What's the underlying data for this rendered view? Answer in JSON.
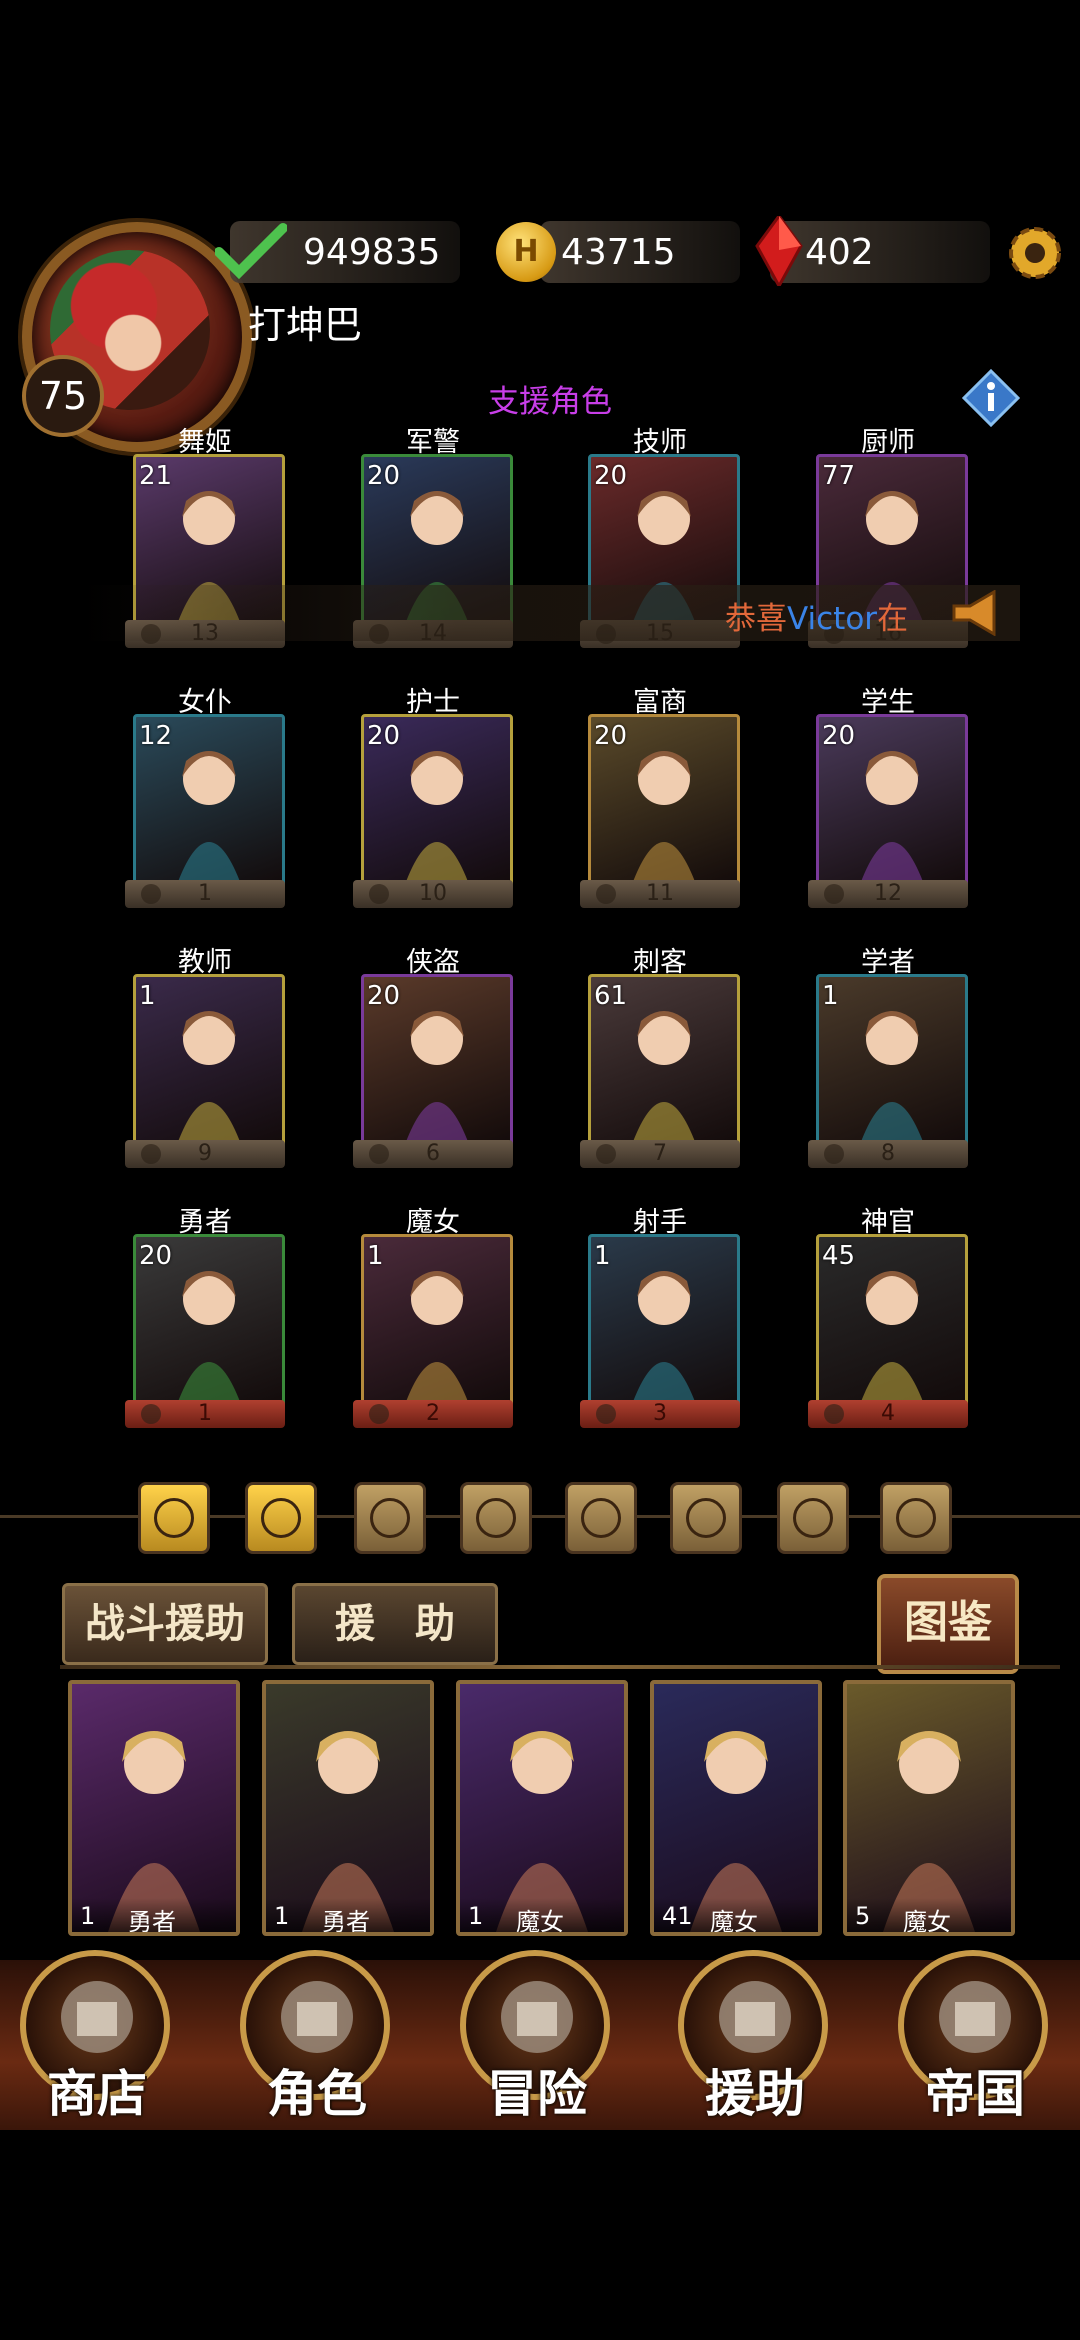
{
  "player": {
    "level": "75",
    "name": "打坤巴"
  },
  "resources": {
    "stamina": "949835",
    "gold": "43715",
    "gems": "402"
  },
  "icons": {
    "coin_letter": "H"
  },
  "section_title": "支援角色",
  "marquee": {
    "prefix": "恭喜",
    "name": "Victor",
    "suffix": "在"
  },
  "characters": [
    {
      "label": "舞姬",
      "count": "21",
      "plate": "13",
      "frame": "#b5a03c"
    },
    {
      "label": "军警",
      "count": "20",
      "plate": "14",
      "frame": "#3a8a3a"
    },
    {
      "label": "技师",
      "count": "20",
      "plate": "15",
      "frame": "#2a7a8a"
    },
    {
      "label": "厨师",
      "count": "77",
      "plate": "16",
      "frame": "#7a3a9a"
    },
    {
      "label": "女仆",
      "count": "12",
      "plate": "1",
      "frame": "#2a7a8a"
    },
    {
      "label": "护士",
      "count": "20",
      "plate": "10",
      "frame": "#b5a03c"
    },
    {
      "label": "富商",
      "count": "20",
      "plate": "11",
      "frame": "#b58a3c"
    },
    {
      "label": "学生",
      "count": "20",
      "plate": "12",
      "frame": "#7a3a9a"
    },
    {
      "label": "教师",
      "count": "1",
      "plate": "9",
      "frame": "#b5a03c"
    },
    {
      "label": "侠盗",
      "count": "20",
      "plate": "6",
      "frame": "#7a3a9a"
    },
    {
      "label": "刺客",
      "count": "61",
      "plate": "7",
      "frame": "#b5a03c"
    },
    {
      "label": "学者",
      "count": "1",
      "plate": "8",
      "frame": "#2a7a8a"
    },
    {
      "label": "勇者",
      "count": "20",
      "plate": "1",
      "frame": "#3a8a3a"
    },
    {
      "label": "魔女",
      "count": "1",
      "plate": "2",
      "frame": "#b58a3c"
    },
    {
      "label": "射手",
      "count": "1",
      "plate": "3",
      "frame": "#2a7a8a"
    },
    {
      "label": "神官",
      "count": "45",
      "plate": "4",
      "frame": "#b5a03c"
    }
  ],
  "tabs": {
    "battle": "战斗援助",
    "assist": "援　助",
    "codex": "图鉴"
  },
  "support_cards": [
    {
      "num": "1",
      "class": "勇者"
    },
    {
      "num": "1",
      "class": "勇者"
    },
    {
      "num": "1",
      "class": "魔女"
    },
    {
      "num": "41",
      "class": "魔女"
    },
    {
      "num": "5",
      "class": "魔女"
    }
  ],
  "nav": [
    {
      "label": "商店",
      "icon": "castle-icon"
    },
    {
      "label": "角色",
      "icon": "hood-icon"
    },
    {
      "label": "冒险",
      "icon": "gate-icon"
    },
    {
      "label": "援助",
      "icon": "girl-icon"
    },
    {
      "label": "帝国",
      "icon": "crown-icon"
    }
  ]
}
